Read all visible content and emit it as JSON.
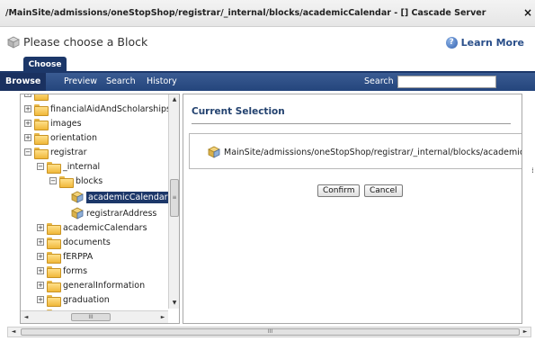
{
  "window": {
    "title": "/MainSite/admissions/oneStopShop/registrar/_internal/blocks/academicCalendar - [] Cascade Server",
    "close_glyph": "×"
  },
  "header": {
    "title": "Please choose a Block",
    "learn_more": "Learn More"
  },
  "tabs": {
    "choose": "Choose"
  },
  "nav": {
    "browse": "Browse",
    "preview": "Preview",
    "search": "Search",
    "history": "History",
    "search_label": "Search",
    "search_value": ""
  },
  "tree": {
    "items": [
      {
        "label": "financialAidAndScholarships",
        "expander": "+",
        "kind": "folder"
      },
      {
        "label": "images",
        "expander": "+",
        "kind": "folder"
      },
      {
        "label": "orientation",
        "expander": "+",
        "kind": "folder"
      },
      {
        "label": "registrar",
        "expander": "−",
        "kind": "folder"
      },
      {
        "label": "_internal",
        "expander": "−",
        "kind": "folder"
      },
      {
        "label": "blocks",
        "expander": "−",
        "kind": "folder"
      },
      {
        "label": "academicCalendar",
        "kind": "block",
        "selected": true
      },
      {
        "label": "registrarAddress",
        "kind": "block"
      },
      {
        "label": "academicCalendars",
        "expander": "+",
        "kind": "folder"
      },
      {
        "label": "documents",
        "expander": "+",
        "kind": "folder"
      },
      {
        "label": "fERPPA",
        "expander": "+",
        "kind": "folder"
      },
      {
        "label": "forms",
        "expander": "+",
        "kind": "folder"
      },
      {
        "label": "generalInformation",
        "expander": "+",
        "kind": "folder"
      },
      {
        "label": "graduation",
        "expander": "+",
        "kind": "folder"
      }
    ]
  },
  "selection": {
    "heading": "Current Selection",
    "path": "MainSite/admissions/oneStopShop/registrar/_internal/blocks/academicCalendar"
  },
  "buttons": {
    "confirm": "Confirm",
    "cancel": "Cancel"
  },
  "scroll": {
    "up": "▲",
    "down": "▼",
    "left": "◄",
    "right": "►",
    "grip": "III",
    "vgrip": "≡",
    "side_nub": "⁞"
  },
  "colors": {
    "primary": "#1c3769",
    "nav": "#2c4d85",
    "heading": "#23426f",
    "folder": "#f0b83a"
  }
}
